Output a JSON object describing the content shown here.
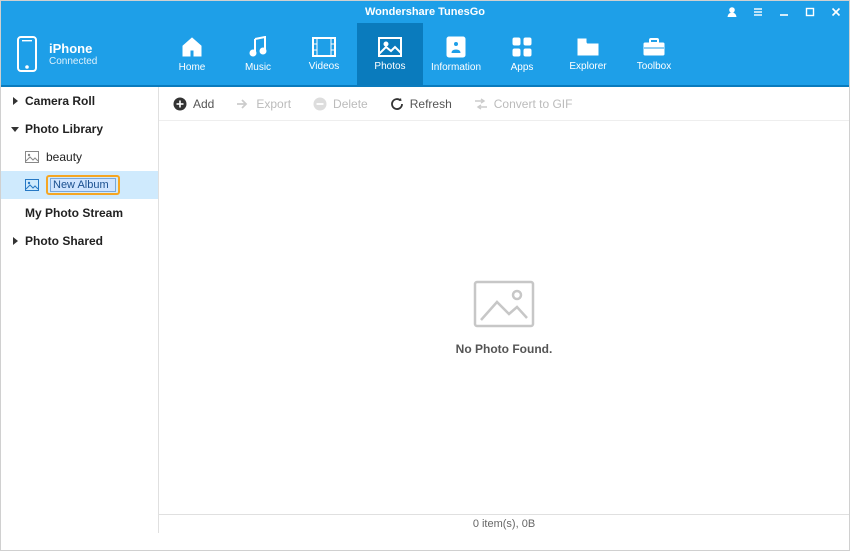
{
  "title": "Wondershare TunesGo",
  "device": {
    "name": "iPhone",
    "status": "Connected"
  },
  "tabs": {
    "home": "Home",
    "music": "Music",
    "videos": "Videos",
    "photos": "Photos",
    "information": "Information",
    "apps": "Apps",
    "explorer": "Explorer",
    "toolbox": "Toolbox"
  },
  "sidebar": {
    "camera_roll": "Camera Roll",
    "photo_library": "Photo Library",
    "beauty": "beauty",
    "new_album": "New Album",
    "my_photo_stream": "My Photo Stream",
    "photo_shared": "Photo Shared"
  },
  "toolbar": {
    "add": "Add",
    "export": "Export",
    "delete": "Delete",
    "refresh": "Refresh",
    "convert": "Convert to GIF"
  },
  "content": {
    "empty": "No Photo Found."
  },
  "status": "0 item(s), 0B"
}
